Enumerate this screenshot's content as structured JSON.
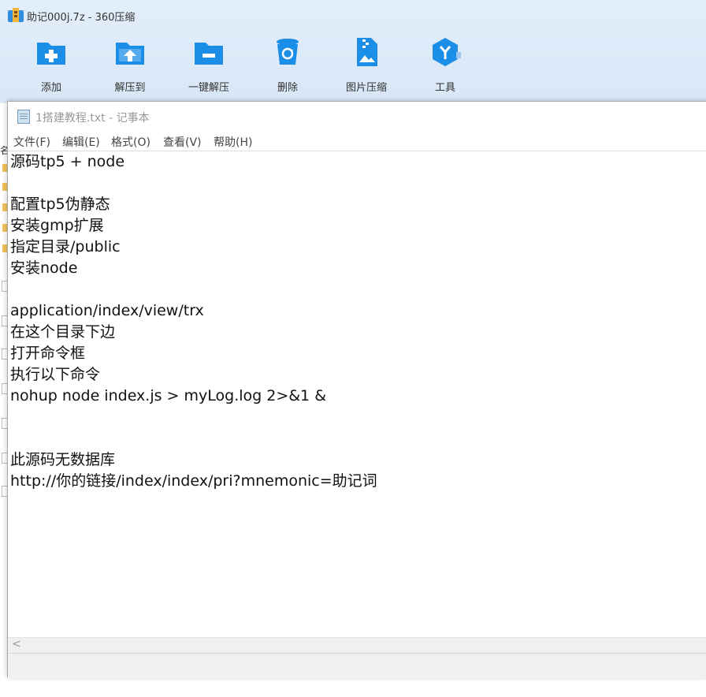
{
  "archive_window": {
    "title": "助记000j.7z - 360压缩",
    "toolbar": [
      {
        "label": "添加",
        "icon": "add-folder-icon"
      },
      {
        "label": "解压到",
        "icon": "extract-to-icon"
      },
      {
        "label": "一键解压",
        "icon": "one-click-extract-icon"
      },
      {
        "label": "删除",
        "icon": "recycle-bin-icon"
      },
      {
        "label": "图片压缩",
        "icon": "image-compress-icon"
      },
      {
        "label": "工具",
        "icon": "tools-icon"
      }
    ],
    "side_peek_char": "名"
  },
  "notepad": {
    "title": "1搭建教程.txt - 记事本",
    "menu": [
      "文件(F)",
      "编辑(E)",
      "格式(O)",
      "查看(V)",
      "帮助(H)"
    ],
    "lines": [
      "源码tp5 + node",
      "",
      "配置tp5伪静态",
      "安装gmp扩展",
      "指定目录/public",
      "安装node",
      "",
      "application/index/view/trx",
      "在这个目录下边",
      "打开命令框",
      "执行以下命令",
      "nohup node index.js > myLog.log 2>&1 &",
      "",
      "",
      "此源码无数据库",
      "http://你的链接/index/index/pri?mnemonic=助记词"
    ],
    "scroll_left_glyph": "<"
  },
  "colors": {
    "accent_blue": "#1b8ee8",
    "title_bar": "#dfe9f6"
  }
}
